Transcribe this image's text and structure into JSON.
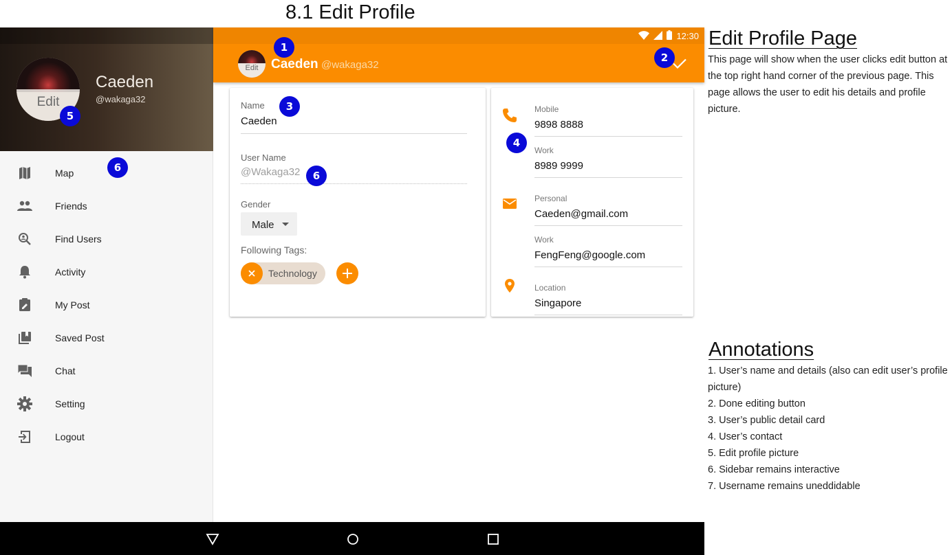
{
  "page_heading": "8.1 Edit Profile",
  "colors": {
    "accent": "#fb8c00",
    "badge": "#0a0ad8"
  },
  "status_bar": {
    "time": "12:30"
  },
  "sidebar": {
    "avatar_edit_label": "Edit",
    "name": "Caeden",
    "handle": "@wakaga32",
    "items": [
      {
        "label": "Map",
        "icon": "map-icon"
      },
      {
        "label": "Friends",
        "icon": "people-icon"
      },
      {
        "label": "Find Users",
        "icon": "search-person-icon"
      },
      {
        "label": "Activity",
        "icon": "bell-icon"
      },
      {
        "label": "My Post",
        "icon": "edit-note-icon"
      },
      {
        "label": "Saved Post",
        "icon": "library-icon"
      },
      {
        "label": "Chat",
        "icon": "chat-icon"
      },
      {
        "label": "Setting",
        "icon": "gear-icon"
      },
      {
        "label": "Logout",
        "icon": "logout-icon"
      }
    ]
  },
  "appbar": {
    "avatar_edit_label": "Edit",
    "name": "Caeden",
    "handle": "@wakaga32"
  },
  "public_card": {
    "name_label": "Name",
    "name_value": "Caeden",
    "username_label": "User Name",
    "username_value": "@Wakaga32",
    "gender_label": "Gender",
    "gender_value": "Male",
    "tags_label": "Following Tags:",
    "tags": [
      "Technology"
    ]
  },
  "contact_card": {
    "mobile_label": "Mobile",
    "mobile_value": "9898 8888",
    "work_phone_label": "Work",
    "work_phone_value": "8989 9999",
    "personal_email_label": "Personal",
    "personal_email_value": "Caeden@gmail.com",
    "work_email_label": "Work",
    "work_email_value": "FengFeng@google.com",
    "location_label": "Location",
    "location_value": "Singapore"
  },
  "badges": [
    "1",
    "2",
    "3",
    "4",
    "5",
    "6",
    "6"
  ],
  "notes": {
    "title": "Edit Profile Page",
    "body": "This page will show when the user clicks edit button at the top right hand corner of the previous page. This page allows the user to edit his details and profile picture.",
    "annotations_title": "Annotations",
    "annotations": [
      "1. User’s name and details (also can edit user’s profile picture)",
      "2. Done editing button",
      "3. User’s public detail card",
      "4. User’s contact",
      "5. Edit profile picture",
      "6. Sidebar remains interactive",
      "7. Username remains uneddidable"
    ]
  }
}
